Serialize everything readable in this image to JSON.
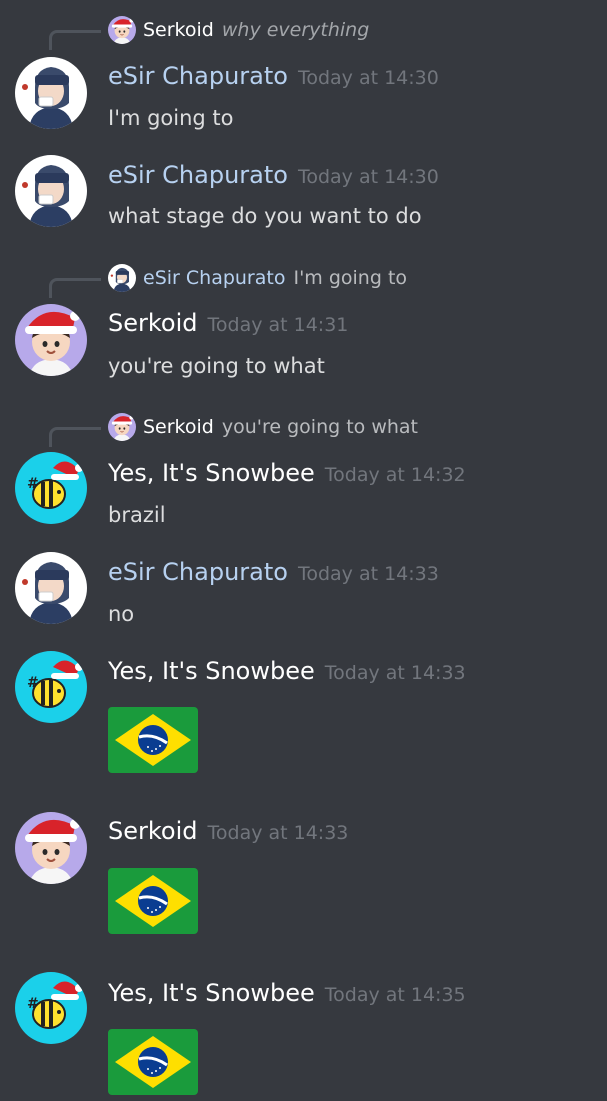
{
  "colors": {
    "background": "#36393f",
    "esir_name": "#b7d1f0",
    "default_name": "#ffffff",
    "timestamp": "#72767d",
    "reply_spine": "#4f545c"
  },
  "users": {
    "serkoid": "Serkoid",
    "esir": "eSir Chapurato",
    "snowbee": "Yes, It's Snowbee"
  },
  "messages": [
    {
      "reply": {
        "author": "Serkoid",
        "text": "why everything",
        "avatar": "serkoid-avatar-icon"
      },
      "author": "eSir Chapurato",
      "timestamp": "Today at 14:30",
      "content": "I'm going to",
      "avatar": "esir-avatar-icon"
    },
    {
      "author": "eSir Chapurato",
      "timestamp": "Today at 14:30",
      "content": "what stage do you want to do",
      "avatar": "esir-avatar-icon"
    },
    {
      "reply": {
        "author": "eSir Chapurato",
        "text": "I'm going to",
        "avatar": "esir-avatar-icon"
      },
      "author": "Serkoid",
      "timestamp": "Today at 14:31",
      "content": "you're going to what",
      "avatar": "serkoid-avatar-icon"
    },
    {
      "reply": {
        "author": "Serkoid",
        "text": "you're going to what",
        "avatar": "serkoid-avatar-icon"
      },
      "author": "Yes, It's Snowbee",
      "timestamp": "Today at 14:32",
      "content": "brazil",
      "avatar": "snowbee-avatar-icon"
    },
    {
      "author": "eSir Chapurato",
      "timestamp": "Today at 14:33",
      "content": "no",
      "avatar": "esir-avatar-icon"
    },
    {
      "author": "Yes, It's Snowbee",
      "timestamp": "Today at 14:33",
      "emoji": "brazil-flag-icon",
      "avatar": "snowbee-avatar-icon"
    },
    {
      "author": "Serkoid",
      "timestamp": "Today at 14:33",
      "emoji": "brazil-flag-icon",
      "avatar": "serkoid-avatar-icon"
    },
    {
      "author": "Yes, It's Snowbee",
      "timestamp": "Today at 14:35",
      "emoji": "brazil-flag-icon",
      "avatar": "snowbee-avatar-icon"
    }
  ]
}
